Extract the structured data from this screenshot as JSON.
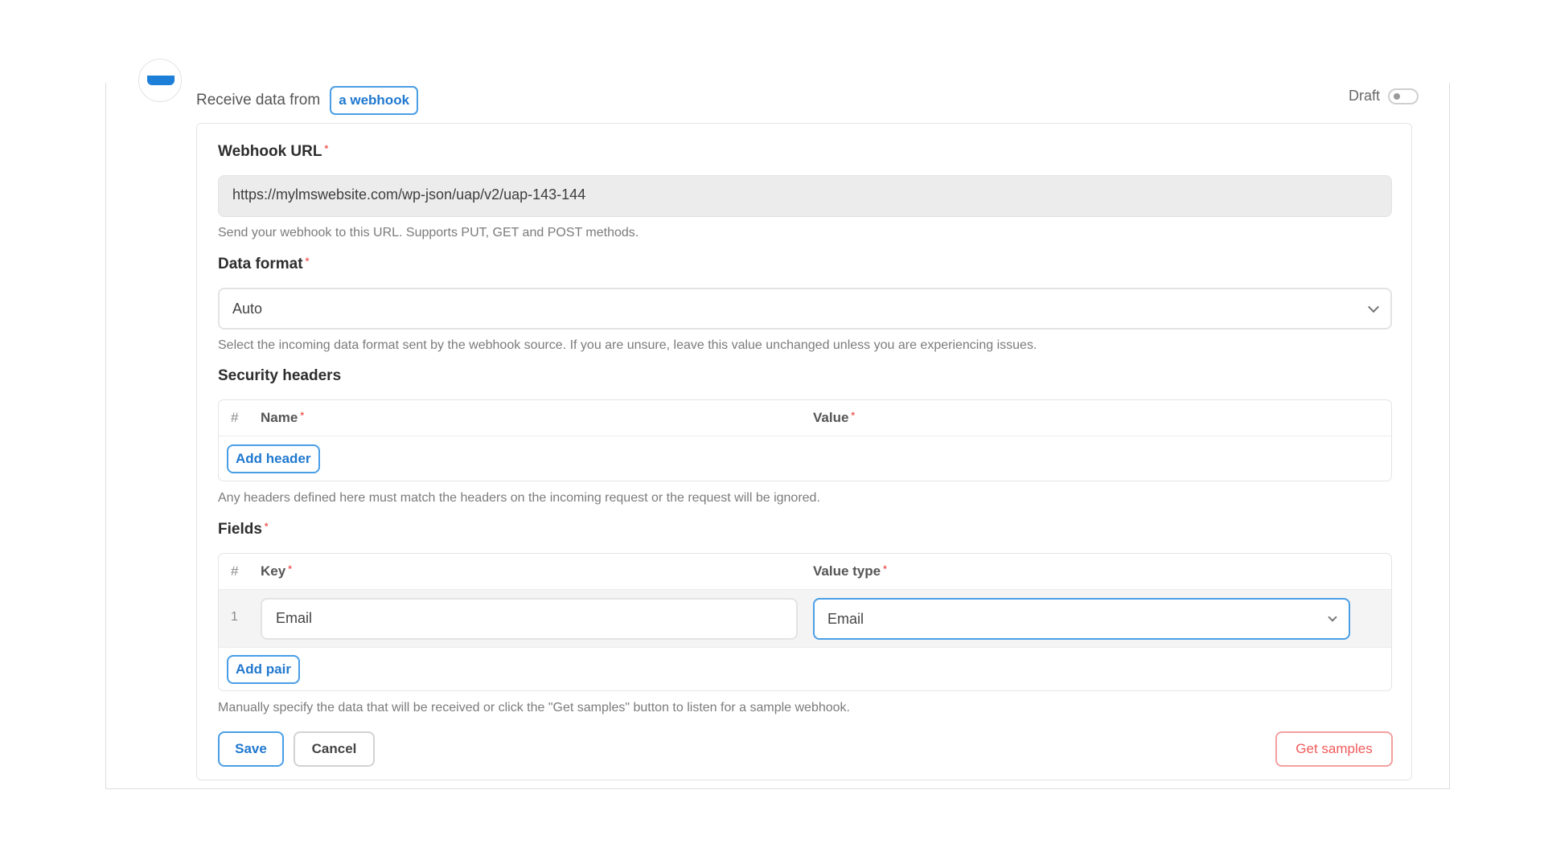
{
  "header": {
    "trigger_text": "Receive data from",
    "source_chip": "a webhook",
    "draft_label": "Draft"
  },
  "webhook_url": {
    "label": "Webhook URL",
    "required_mark": "*",
    "value": "https://mylmswebsite.com/wp-json/uap/v2/uap-143-144",
    "help": "Send your webhook to this URL. Supports PUT, GET and POST methods."
  },
  "data_format": {
    "label": "Data format",
    "required_mark": "*",
    "selected": "Auto",
    "help": "Select the incoming data format sent by the webhook source. If you are unsure, leave this value unchanged unless you are experiencing issues."
  },
  "security_headers": {
    "label": "Security headers",
    "columns": {
      "hash": "#",
      "name": "Name",
      "value": "Value"
    },
    "required_mark": "*",
    "add_button": "Add header",
    "help": "Any headers defined here must match the headers on the incoming request or the request will be ignored."
  },
  "fields": {
    "label": "Fields",
    "required_mark": "*",
    "columns": {
      "hash": "#",
      "key": "Key",
      "value_type": "Value type"
    },
    "rows": [
      {
        "index": "1",
        "key": "Email",
        "value_type": "Email"
      }
    ],
    "add_button": "Add pair",
    "help": "Manually specify the data that will be received or click the \"Get samples\" button to listen for a sample webhook."
  },
  "actions": {
    "save": "Save",
    "cancel": "Cancel",
    "get_samples": "Get samples"
  },
  "colors": {
    "accent_blue": "#1f78cf",
    "danger_red": "#f05a5a",
    "url_bg": "#ececec"
  }
}
